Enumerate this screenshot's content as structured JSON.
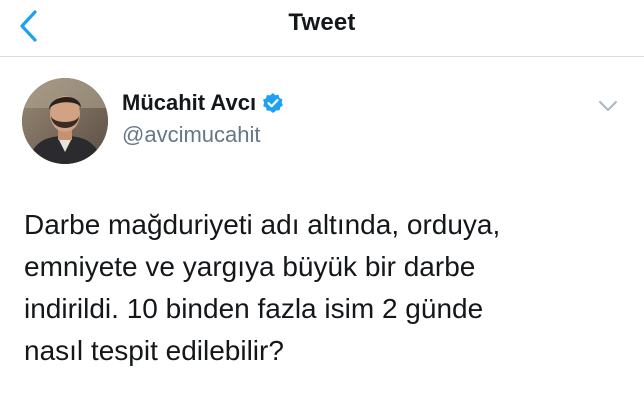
{
  "nav": {
    "title": "Tweet",
    "back_icon": "chevron-left-icon"
  },
  "tweet": {
    "author": {
      "display_name": "Mücahit Avcı",
      "handle": "@avcimucahit",
      "verified": true,
      "verified_icon": "verified-badge-icon"
    },
    "menu_icon": "chevron-down-icon",
    "text_lines": [
      "Darbe mağduriyeti adı altında, orduya,",
      "emniyete ve yargıya büyük bir darbe",
      "indirildi. 10 binden fazla isim 2 günde",
      "nasıl tespit edilebilir?"
    ]
  },
  "colors": {
    "accent": "#1da1f2",
    "text_primary": "#14171a",
    "text_secondary": "#657786",
    "divider": "#d8dde2"
  }
}
